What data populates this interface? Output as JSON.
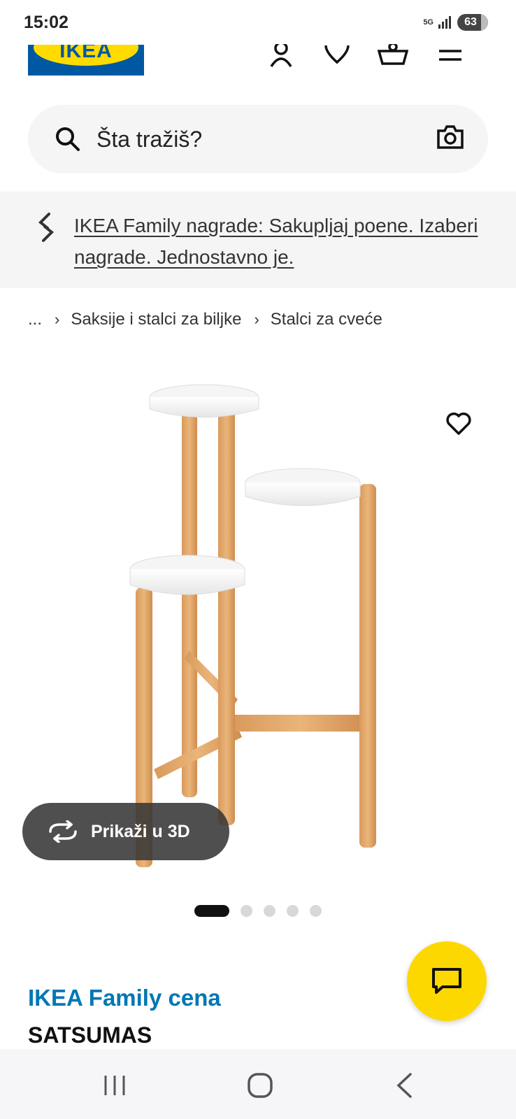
{
  "status_bar": {
    "time": "15:02",
    "network": "5G",
    "battery": "63"
  },
  "header": {
    "logo_text": "IKEA",
    "icons": [
      "account-icon",
      "heart-icon",
      "basket-icon",
      "menu-icon"
    ]
  },
  "search": {
    "placeholder": "Šta tražiš?"
  },
  "promo": {
    "text": "IKEA Family nagrade: Sakupljaj poene. Izaberi nagrade. Jednostavno je."
  },
  "breadcrumb": {
    "ellipsis": "...",
    "items": [
      "Saksije i stalci za biljke",
      "Stalci za cveće"
    ]
  },
  "gallery": {
    "view_3d_label": "Prikaži u 3D",
    "image_count": 5,
    "active_index": 0
  },
  "product": {
    "price_label": "IKEA Family cena",
    "name": "SATSUMAS"
  },
  "colors": {
    "ikea_blue": "#0058a3",
    "ikea_yellow": "#ffdb00",
    "family_blue": "#0077b3",
    "chat_yellow": "#fdd800"
  }
}
